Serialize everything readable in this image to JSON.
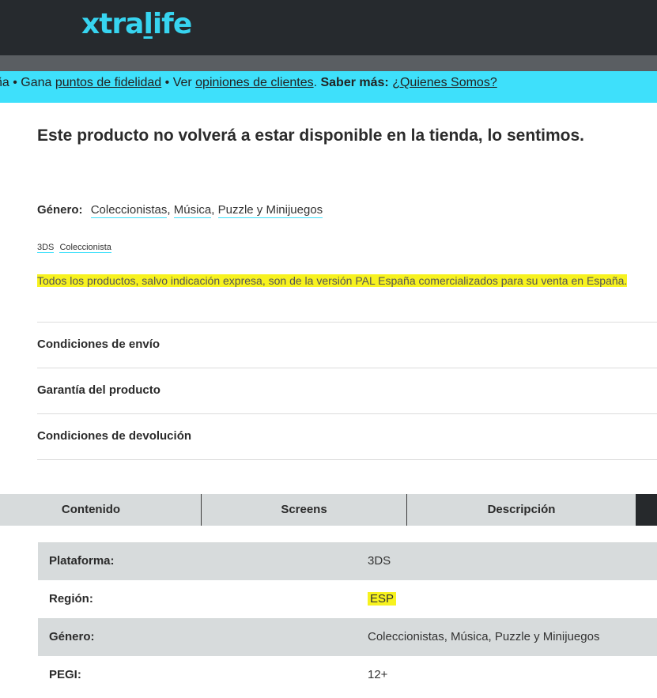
{
  "header": {
    "logo_prefix": "xtra",
    "logo_underlined": "l",
    "logo_suffix": "ife"
  },
  "infobar": {
    "lead": "ña • Gana ",
    "loyalty_link": "puntos de fidelidad",
    "mid": " • Ver ",
    "reviews_link": "opiniones de clientes",
    "dot": ". ",
    "more_label": "Saber más:",
    "about_link": "¿Quienes Somos?"
  },
  "product": {
    "unavailable_message": "Este producto no volverá a estar disponible en la tienda, lo sentimos.",
    "genre_label": "Género:",
    "genres": [
      "Coleccionistas",
      "Música",
      "Puzzle y Minijuegos"
    ],
    "tags": [
      "3DS",
      "Coleccionista"
    ],
    "notice": "Todos los productos, salvo indicación expresa, son de la versión PAL España comercializados para su venta en España."
  },
  "accordion": [
    "Condiciones de envío",
    "Garantía del producto",
    "Condiciones de devolución"
  ],
  "tabs": [
    "Contenido",
    "Screens",
    "Descripción"
  ],
  "specs": [
    {
      "key": "Plataforma:",
      "value": "3DS"
    },
    {
      "key": "Región:",
      "value": "ESP"
    },
    {
      "key": "Género:",
      "value": "Coleccionistas, Música, Puzzle y Minijuegos"
    },
    {
      "key": "PEGI:",
      "value": "12+"
    }
  ],
  "colors": {
    "accent": "#3ee0fb",
    "dark": "#262a2e",
    "highlight": "#f7f21f",
    "tab_bg": "#d7dbdc"
  }
}
